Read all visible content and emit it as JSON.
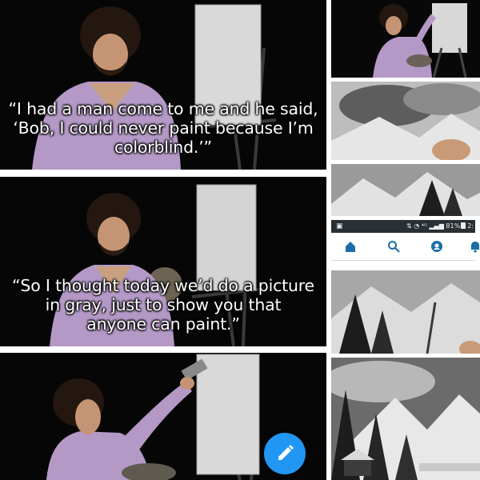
{
  "panels": [
    {
      "caption_lines": [
        "“I had a man come to me and he said,",
        "‘Bob, I could never paint because I’m",
        "colorblind.’”"
      ]
    },
    {
      "caption_lines": [
        "“So I thought today we’d do a picture",
        "in gray, just to show you that",
        "anyone can paint.”"
      ]
    },
    {
      "caption_lines": []
    }
  ],
  "phone": {
    "signal_text": "⁴ᴳ",
    "battery_text": "81%",
    "clock_text": "2:",
    "nav_icons": [
      "home-icon",
      "search-icon",
      "face-icon",
      "bell-icon"
    ],
    "accent_color": "#1b6ea8"
  },
  "fab": {
    "icon": "pencil-icon",
    "color": "#2196f3"
  }
}
